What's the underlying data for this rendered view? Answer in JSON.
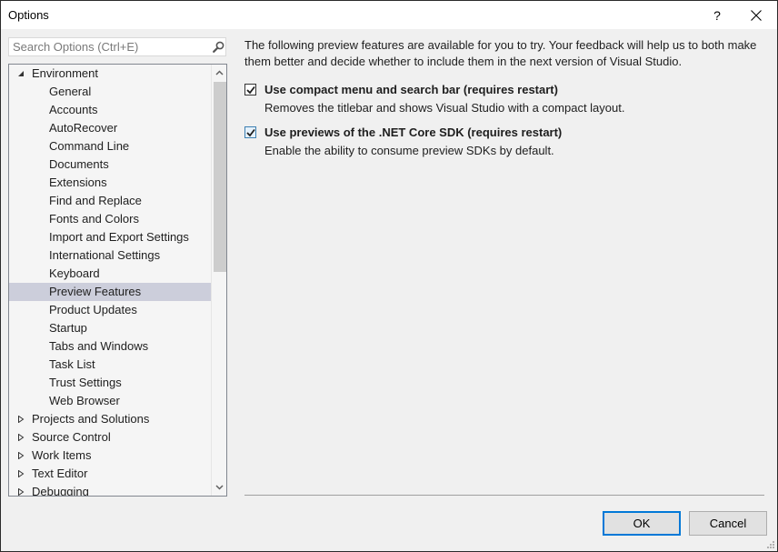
{
  "window": {
    "title": "Options",
    "help_label": "?",
    "close_icon": "close-icon"
  },
  "search": {
    "placeholder": "Search Options (Ctrl+E)",
    "value": "",
    "icon": "search-icon"
  },
  "tree": {
    "items": [
      {
        "label": "Environment",
        "level": 0,
        "expander": "expanded",
        "selected": false
      },
      {
        "label": "General",
        "level": 1,
        "selected": false
      },
      {
        "label": "Accounts",
        "level": 1,
        "selected": false
      },
      {
        "label": "AutoRecover",
        "level": 1,
        "selected": false
      },
      {
        "label": "Command Line",
        "level": 1,
        "selected": false
      },
      {
        "label": "Documents",
        "level": 1,
        "selected": false
      },
      {
        "label": "Extensions",
        "level": 1,
        "selected": false
      },
      {
        "label": "Find and Replace",
        "level": 1,
        "selected": false
      },
      {
        "label": "Fonts and Colors",
        "level": 1,
        "selected": false
      },
      {
        "label": "Import and Export Settings",
        "level": 1,
        "selected": false
      },
      {
        "label": "International Settings",
        "level": 1,
        "selected": false
      },
      {
        "label": "Keyboard",
        "level": 1,
        "selected": false
      },
      {
        "label": "Preview Features",
        "level": 1,
        "selected": true
      },
      {
        "label": "Product Updates",
        "level": 1,
        "selected": false
      },
      {
        "label": "Startup",
        "level": 1,
        "selected": false
      },
      {
        "label": "Tabs and Windows",
        "level": 1,
        "selected": false
      },
      {
        "label": "Task List",
        "level": 1,
        "selected": false
      },
      {
        "label": "Trust Settings",
        "level": 1,
        "selected": false
      },
      {
        "label": "Web Browser",
        "level": 1,
        "selected": false
      },
      {
        "label": "Projects and Solutions",
        "level": 0,
        "expander": "collapsed",
        "selected": false
      },
      {
        "label": "Source Control",
        "level": 0,
        "expander": "collapsed",
        "selected": false
      },
      {
        "label": "Work Items",
        "level": 0,
        "expander": "collapsed",
        "selected": false
      },
      {
        "label": "Text Editor",
        "level": 0,
        "expander": "collapsed",
        "selected": false
      },
      {
        "label": "Debugging",
        "level": 0,
        "expander": "collapsed",
        "selected": false
      }
    ]
  },
  "content": {
    "intro": "The following preview features are available for you to try. Your feedback will help us to both make them better and decide whether to include them in the next version of Visual Studio.",
    "options": [
      {
        "label": "Use compact menu and search bar (requires restart)",
        "description": "Removes the titlebar and shows Visual Studio with a compact layout.",
        "checked": true
      },
      {
        "label": "Use previews of the .NET Core SDK (requires restart)",
        "description": "Enable the ability to consume preview SDKs by default.",
        "checked": true
      }
    ]
  },
  "footer": {
    "ok_label": "OK",
    "cancel_label": "Cancel"
  },
  "colors": {
    "accent": "#0078d7",
    "selected_row": "#cccedb",
    "background": "#f0f0f0"
  }
}
